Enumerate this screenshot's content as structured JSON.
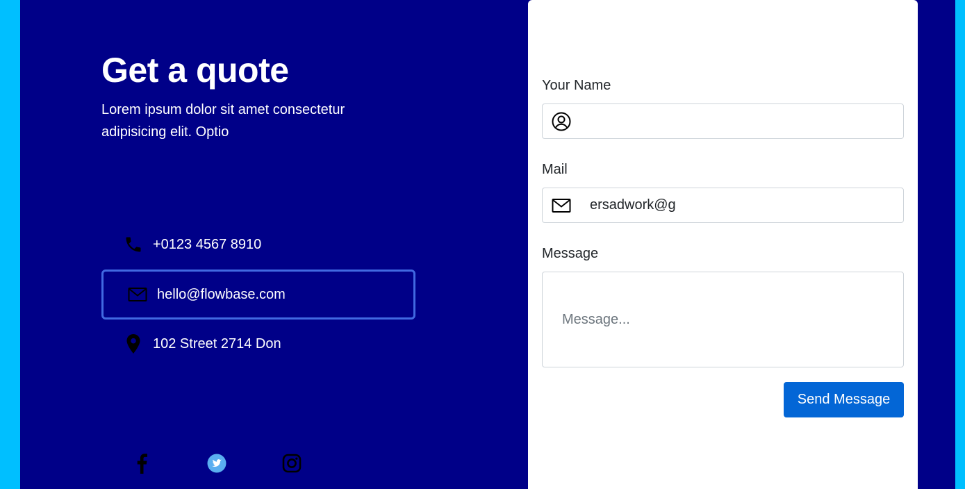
{
  "colors": {
    "outer_background": "#00bfff",
    "panel_background": "#000088",
    "card_background": "#ffffff",
    "active_border": "#4169e1",
    "button_background": "#0366d6",
    "twitter_icon": "#5aaef0"
  },
  "hero": {
    "title": "Get a quote",
    "subtitle": "Lorem ipsum dolor sit amet consectetur adipisicing elit. Optio"
  },
  "contacts": [
    {
      "icon": "phone-icon",
      "text": "+0123 4567 8910"
    },
    {
      "icon": "envelope-icon",
      "text": "hello@flowbase.com",
      "selected": true
    },
    {
      "icon": "map-pin-icon",
      "text": "102 Street 2714 Don"
    }
  ],
  "social": [
    "facebook-icon",
    "twitter-icon",
    "instagram-icon"
  ],
  "form": {
    "name_label": "Your Name",
    "name_value": "",
    "name_icon": "user-circle-icon",
    "mail_label": "Mail",
    "mail_value": "ersadwork@g",
    "mail_icon": "envelope-icon",
    "message_label": "Message",
    "message_placeholder": "Message...",
    "send_label": "Send Message"
  }
}
